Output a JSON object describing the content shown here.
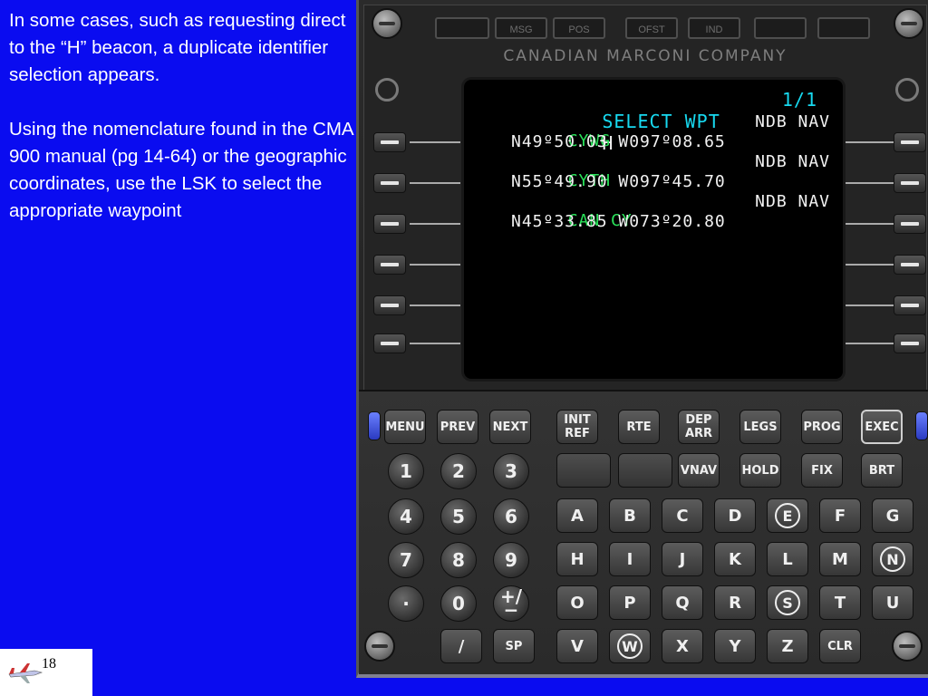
{
  "slide": {
    "paragraphs": [
      "In some cases, such as requesting direct to the “H” beacon, a duplicate identifier selection appears.",
      "Using the nomenclature found in the CMA 900 manual (pg 14-64) or the geographic coordinates, use the LSK to select the appropriate waypoint"
    ],
    "page_number": "18"
  },
  "cdu": {
    "brand": "CANADIAN MARCONI COMPANY",
    "annunciators": [
      "MSG",
      "POS",
      "OFST",
      "IND"
    ],
    "screen": {
      "title": "SELECT WPT",
      "ident": "H",
      "page": "1/1",
      "entries": [
        {
          "ident": "CYWG",
          "type": "NDB NAV",
          "coords": "N49º50.03 W097º08.65"
        },
        {
          "ident": "CYTH",
          "type": "NDB NAV",
          "coords": "N55º49.90 W097º45.70"
        },
        {
          "ident": "CAN CY",
          "type": "NDB NAV",
          "coords": "N45º33.85 W073º20.80"
        }
      ]
    },
    "keys": {
      "menu": "MENU",
      "prev": "PREV",
      "next": "NEXT",
      "init_ref": "INIT REF",
      "rte": "RTE",
      "dep_arr": "DEP ARR",
      "legs": "LEGS",
      "prog": "PROG",
      "exec": "EXEC",
      "vnav": "VNAV",
      "hold": "HOLD",
      "fix": "FIX",
      "brt": "BRT",
      "k1": "1",
      "k2": "2",
      "k3": "3",
      "k4": "4",
      "k5": "5",
      "k6": "6",
      "k7": "7",
      "k8": "8",
      "k9": "9",
      "dot": "·",
      "k0": "0",
      "plusminus": "+/−",
      "A": "A",
      "B": "B",
      "C": "C",
      "D": "D",
      "E": "E",
      "F": "F",
      "G": "G",
      "H": "H",
      "I": "I",
      "J": "J",
      "K": "K",
      "L": "L",
      "M": "M",
      "N": "N",
      "O": "O",
      "P": "P",
      "Q": "Q",
      "R": "R",
      "S": "S",
      "T": "T",
      "U": "U",
      "slash": "/",
      "sp": "SP",
      "V": "V",
      "W": "W",
      "X": "X",
      "Y": "Y",
      "Z": "Z",
      "clr": "CLR"
    }
  }
}
